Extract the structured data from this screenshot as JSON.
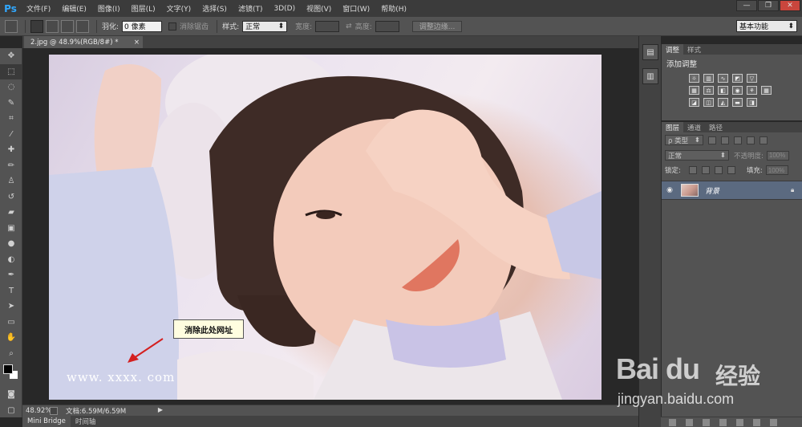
{
  "app": {
    "logo": "Ps"
  },
  "menu": [
    "文件(F)",
    "编辑(E)",
    "图像(I)",
    "图层(L)",
    "文字(Y)",
    "选择(S)",
    "滤镜(T)",
    "3D(D)",
    "视图(V)",
    "窗口(W)",
    "帮助(H)"
  ],
  "window_controls": {
    "minimize": "—",
    "restore": "❐",
    "close": "✕"
  },
  "options": {
    "feather_label": "羽化:",
    "feather_value": "0 像素",
    "antialias_label": "消除锯齿",
    "style_label": "样式:",
    "style_value": "正常",
    "width_label": "宽度:",
    "height_label": "高度:",
    "refine_edge_button": "调整边缘...",
    "workspace": "基本功能"
  },
  "document": {
    "tab_title": "2.jpg @ 48.9%(RGB/8#) *",
    "tab_close": "×",
    "callout_text": "消除此处网址",
    "watermark_url": "www. xxxx. com"
  },
  "status": {
    "zoom": "48.92%",
    "doc_label": "文档:6.59M/6.59M"
  },
  "bottom_tabs": [
    "Mini Bridge",
    "时间轴"
  ],
  "adjust_panel": {
    "tabs": [
      "调整",
      "样式"
    ],
    "title": "添加调整"
  },
  "layers_panel": {
    "tabs": [
      "图层",
      "通道",
      "路径"
    ],
    "filter_label": "ρ 类型",
    "blend_mode": "正常",
    "opacity_label": "不透明度:",
    "opacity_value": "100%",
    "lock_label": "锁定:",
    "fill_label": "填充:",
    "fill_value": "100%",
    "layer_name": "背景"
  },
  "watermark": {
    "logo_text": "Bai du",
    "cn_text": "经验",
    "url": "jingyan.baidu.com"
  }
}
